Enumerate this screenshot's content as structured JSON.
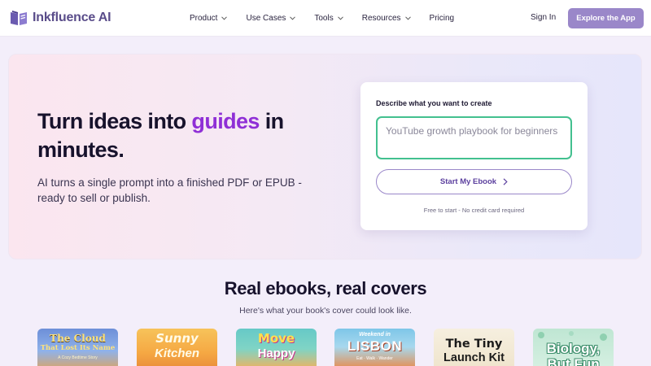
{
  "nav": {
    "brand": "Inkfluence AI",
    "menu": [
      {
        "label": "Product",
        "has_dropdown": true
      },
      {
        "label": "Use Cases",
        "has_dropdown": true
      },
      {
        "label": "Tools",
        "has_dropdown": true
      },
      {
        "label": "Resources",
        "has_dropdown": true
      },
      {
        "label": "Pricing",
        "has_dropdown": false
      }
    ],
    "sign_in": "Sign In",
    "cta": "Explore the App"
  },
  "hero": {
    "title_before": "Turn ideas into ",
    "title_accent": "guides",
    "title_after": " in minutes.",
    "subtitle": "AI turns a single prompt into a finished PDF or EPUB - ready to sell or publish.",
    "form": {
      "label": "Describe what you want to create",
      "placeholder": "YouTube growth playbook for beginners",
      "button": "Start My Ebook",
      "note": "Free to start - No credit card required"
    }
  },
  "showcase": {
    "title": "Real ebooks, real covers",
    "subtitle": "Here's what your book's cover could look like.",
    "covers": [
      {
        "line1": "The Cloud",
        "line2": "That Lost Its Name",
        "tag": "A Cozy Bedtime Story"
      },
      {
        "line1": "Sunny",
        "line2": "Kitchen"
      },
      {
        "line1": "Move",
        "line2": "Happy"
      },
      {
        "top": "Weekend in",
        "line1": "LISBON",
        "tag": "Eat · Walk · Wander"
      },
      {
        "line1": "The Tiny",
        "line2": "Launch Kit"
      },
      {
        "line1": "Biology,",
        "line2": "But Fun"
      }
    ]
  },
  "colors": {
    "accent": "#8f2fd6",
    "cta": "#9a87c9",
    "input_border": "#43c08f"
  }
}
